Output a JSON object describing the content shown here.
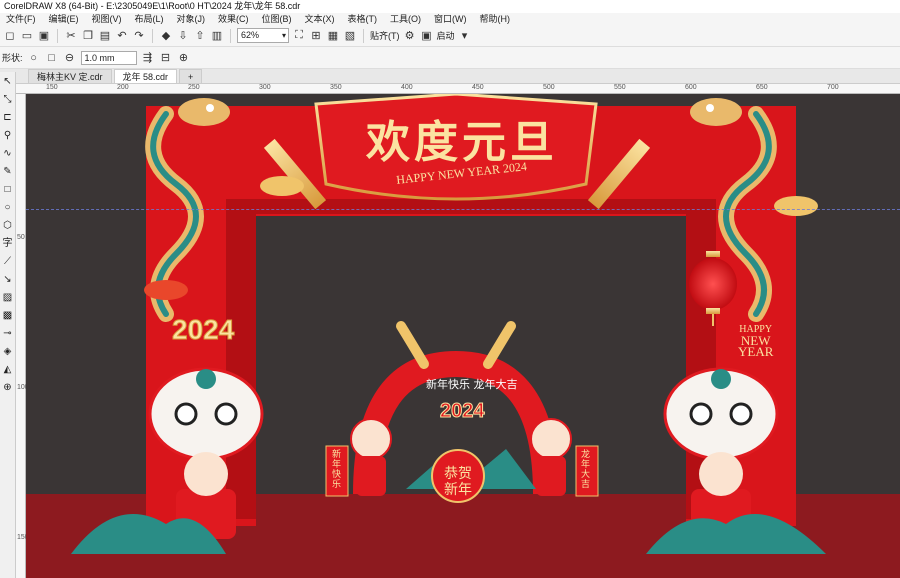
{
  "window": {
    "title": "CorelDRAW X8 (64-Bit) - E:\\2305049E\\1\\Root\\0 HT\\2024 龙年\\龙年 58.cdr"
  },
  "menu": [
    "文件(F)",
    "编辑(E)",
    "视图(V)",
    "布局(L)",
    "对象(J)",
    "效果(C)",
    "位图(B)",
    "文本(X)",
    "表格(T)",
    "工具(O)",
    "窗口(W)",
    "帮助(H)"
  ],
  "toolbar": {
    "zoom": "62%",
    "snap_label": "贴齐(T)",
    "launch_label": "启动"
  },
  "property_bar": {
    "shape_label": "形状:",
    "outline_width": "1.0 mm"
  },
  "tabs": [
    "梅林主KV 定.cdr",
    "龙年 58.cdr"
  ],
  "ruler": {
    "top": [
      "150",
      "200",
      "250",
      "300",
      "350",
      "400",
      "450",
      "500",
      "550",
      "600",
      "650",
      "700"
    ],
    "left": [
      "50",
      "100",
      "150"
    ]
  },
  "artwork": {
    "banner_title": "欢度元旦",
    "banner_subtitle": "HAPPY NEW YEAR 2024",
    "year_left": "2024",
    "happy_new_year": [
      "HAPPY",
      "NEW",
      "YEAR"
    ],
    "arch_text": "新年快乐 龙年大吉",
    "arch_year": "2024",
    "center_blessing": [
      "恭贺",
      "新年"
    ],
    "scroll_left": "新年快乐",
    "scroll_right": "龙年大吉"
  },
  "colors": {
    "red": "#e0181e",
    "dark_red": "#8d1a1f",
    "gold": "#f0c46a",
    "canvas": "#3a3535",
    "teal": "#2a8d86"
  }
}
